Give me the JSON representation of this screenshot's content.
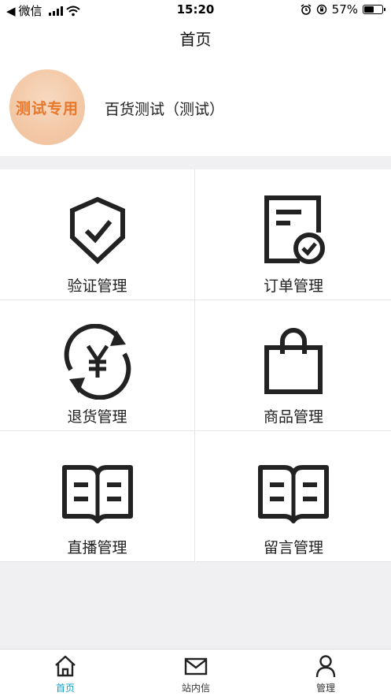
{
  "status_bar": {
    "back_app": "微信",
    "time": "15:20",
    "battery_percent": "57%",
    "battery_level": 0.57
  },
  "nav": {
    "title": "首页"
  },
  "store": {
    "logo_text": "测试专用",
    "name": "百货测试（测试）"
  },
  "menu": [
    {
      "label": "验证管理",
      "icon": "shield-check-icon"
    },
    {
      "label": "订单管理",
      "icon": "order-document-icon"
    },
    {
      "label": "退货管理",
      "icon": "yen-refresh-icon"
    },
    {
      "label": "商品管理",
      "icon": "shopping-bag-icon"
    },
    {
      "label": "直播管理",
      "icon": "open-book-icon"
    },
    {
      "label": "留言管理",
      "icon": "open-book-icon"
    }
  ],
  "tabs": [
    {
      "label": "首页",
      "icon": "home-icon",
      "active": true
    },
    {
      "label": "站内信",
      "icon": "mail-icon",
      "active": false
    },
    {
      "label": "管理",
      "icon": "user-icon",
      "active": false
    }
  ],
  "colors": {
    "accent": "#1aa0c8",
    "logo_text": "#e8782c",
    "icon_stroke": "#222222",
    "background": "#f0f0f3"
  }
}
